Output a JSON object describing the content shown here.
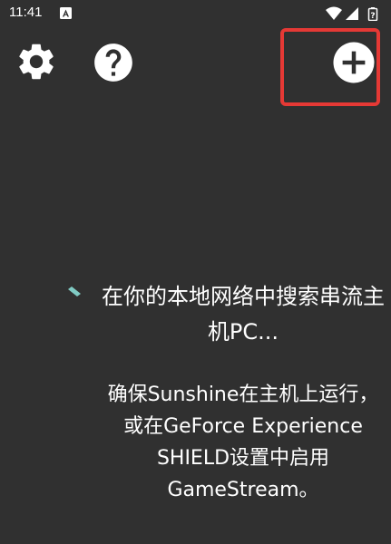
{
  "status_bar": {
    "time": "11:41",
    "icons": [
      "notification-a-icon",
      "wifi-icon",
      "signal-icon",
      "battery-icon"
    ]
  },
  "toolbar": {
    "settings_icon": "gear-icon",
    "help_icon": "help-circle-icon",
    "add_icon": "add-circle-icon"
  },
  "main": {
    "searching_text": "在你的本地网络中搜索串流主机PC...",
    "hint_text": "确保Sunshine在主机上运行，或在GeForce Experience SHIELD设置中启用GameStream。"
  },
  "colors": {
    "background": "#303030",
    "foreground": "#ffffff",
    "spinner": "#80cbc4",
    "highlight": "#e53935"
  }
}
